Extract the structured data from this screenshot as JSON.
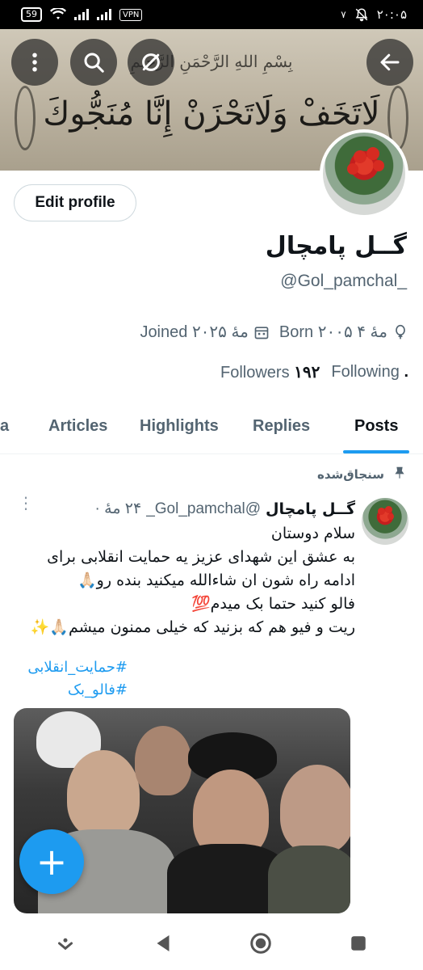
{
  "status_bar": {
    "time": "۲۰:۰۵",
    "battery": "59",
    "vpn": "VPN",
    "notif_indicator": "۷"
  },
  "banner": {
    "small_line": "بِسْمِ اللهِ الرَّحْمَنِ الرَّحِيمِ",
    "big_line": "لَاتَخَفْ وَلَاتَحْزَنْ إِنَّا مُنَجُّوكَ"
  },
  "header_actions": {
    "back_icon": "arrow-left-icon",
    "more_icon": "more-vertical-icon",
    "search_icon": "search-icon",
    "grok_icon": "grok-icon"
  },
  "profile": {
    "edit_label": "Edit profile",
    "name": "گــل پامچال",
    "handle": "@Gol_pamchal_",
    "joined": "Joined مهٔ ۲۰۲۵",
    "born": "Born مهٔ ۴ ۲۰۰۵",
    "followers_label": "Followers",
    "followers_count": "۱۹۲",
    "following_label": "Following",
    "following_count": "."
  },
  "tabs": [
    {
      "label": "a"
    },
    {
      "label": "Articles"
    },
    {
      "label": "Highlights"
    },
    {
      "label": "Replies"
    },
    {
      "label": "Posts"
    }
  ],
  "pinned_label": "سنجاق‌شده",
  "tweet": {
    "author_name": "گــل پامچال",
    "author_handle": "@Gol_pamchal_",
    "time": "۲۴ مهٔ ·",
    "lines": [
      "سلام دوستان",
      "به عشق این شهدای عزیز یه حمایت انقلابی  برای",
      "ادامه راه شون ان شاءالله میکنید بنده رو🙏🏻",
      "فالو کنید حتما بک میدم💯",
      "ریت و فیو هم که بزنید که خیلی ممنون میشم🙏🏻✨"
    ],
    "hashtags": [
      "#حمایت_انقلابی",
      "#فالو_بک"
    ]
  },
  "fab_label": "+",
  "colors": {
    "accent": "#1d9bf0",
    "text_primary": "#0f1419",
    "text_secondary": "#536471"
  }
}
